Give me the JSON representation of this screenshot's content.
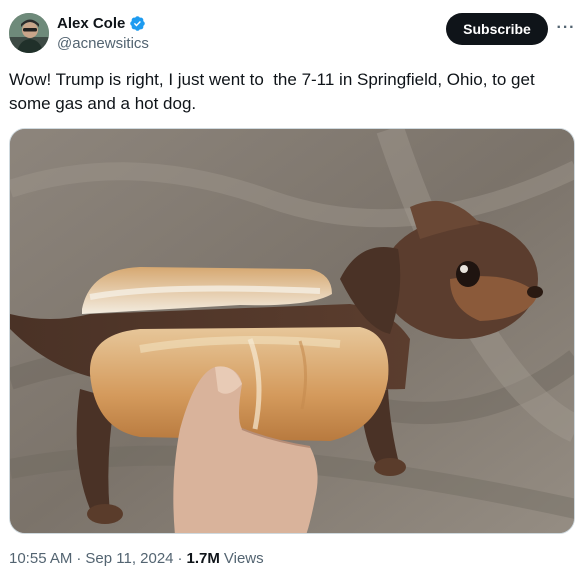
{
  "author": {
    "display_name": "Alex Cole",
    "handle": "@acnewsitics",
    "avatar_icon": "avatar-photo",
    "verified_icon": "verified-badge-icon",
    "verified_color": "#1d9bf0"
  },
  "actions": {
    "subscribe_label": "Subscribe",
    "more_label": "···"
  },
  "tweet": {
    "text": "Wow! Trump is right, I just went to  the 7-11 in Springfield, Ohio, to get some gas and a hot dog."
  },
  "meta": {
    "time": "10:55 AM",
    "separator": "·",
    "date": "Sep 11, 2024",
    "views_count": "1.7M",
    "views_label": "Views"
  },
  "colors": {
    "text_primary": "#0f1419",
    "text_secondary": "#536471",
    "button_bg": "#0f1419",
    "border": "#cfd9de"
  }
}
